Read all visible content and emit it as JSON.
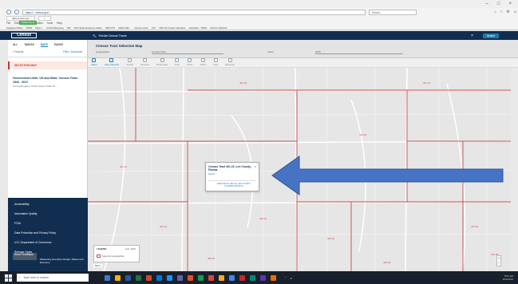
{
  "browser": {
    "url": "https://...census.gov/...",
    "search": "Search...",
    "tabs": [
      "data.census.gov"
    ],
    "menu": [
      "File",
      "Edit",
      "View",
      "Favorites",
      "Tools",
      "Help"
    ],
    "green_label": "TPMA Home",
    "favorites": [
      "Suggested Sites",
      "TPMA",
      "https://..",
      "Ad Dev/Dempsey",
      "IRS",
      "2021 State Employee Salary",
      "NRP PTS",
      "SPEA-CEF...",
      "Census Home",
      "TAX",
      "TMA Tax Impact Calculator",
      "Calculator - TPMA",
      "Monitor Statistics"
    ]
  },
  "header": {
    "logo": "Census",
    "search": "Florida Census Tracts",
    "search_button": "Search"
  },
  "left_panel": {
    "tabs": [
      "ALL",
      "TABLES",
      "MAPS",
      "PAGES"
    ],
    "results": "1 Results",
    "filter_download": "Filter | Download",
    "selection_label": "SELECTION MAP",
    "card_title": "Government Units: US and State: Census Years 1942 - 2017",
    "card_sub": "Survey/Program: Public Sector Table ID: ...",
    "footer": [
      "Accessibility",
      "Information Quality",
      "FOIA",
      "Data Protection and Privacy Policy",
      "U.S. Department of Commerce",
      "Release Notes"
    ],
    "chat": "Send Feedback",
    "footer_text": "Measuring America's People, Places and Economy"
  },
  "map": {
    "title": "Census Tract Selection Map",
    "filters": [
      "Geographies",
      "Census Tract",
      "Years",
      "2010"
    ],
    "tools": [
      "Select",
      "Clear Selected",
      "Identify",
      "Measure",
      "Bookmarks",
      "Print",
      "Share",
      "Tables",
      "Data",
      "Basemap"
    ],
    "popup": {
      "title": "Census Tract 401.22, Lee County, Florida",
      "select": "Select",
      "footer": "VIEW TRACT 401.22, LEE COUNTY, FLORIDA PROFILE"
    },
    "legend_title": "LEGEND",
    "legend_scale": "Year: 2010",
    "legend_item": "Selected Geographies",
    "scale": "500 ft",
    "labels": [
      "401.21",
      "401.22",
      "401.23",
      "401.14",
      "401.17",
      "401.16",
      "401.12",
      "401.13",
      "402.01",
      "402.06",
      "402.07",
      "402.05"
    ]
  },
  "taskbar": {
    "search": "Type here to search",
    "time": "8:51 AM",
    "date": "10/4/2019"
  },
  "colors": {
    "navy": "#112e51",
    "accent": "#1b7ba8",
    "boundary": "#c84a4a",
    "arrow": "#4673c4"
  }
}
